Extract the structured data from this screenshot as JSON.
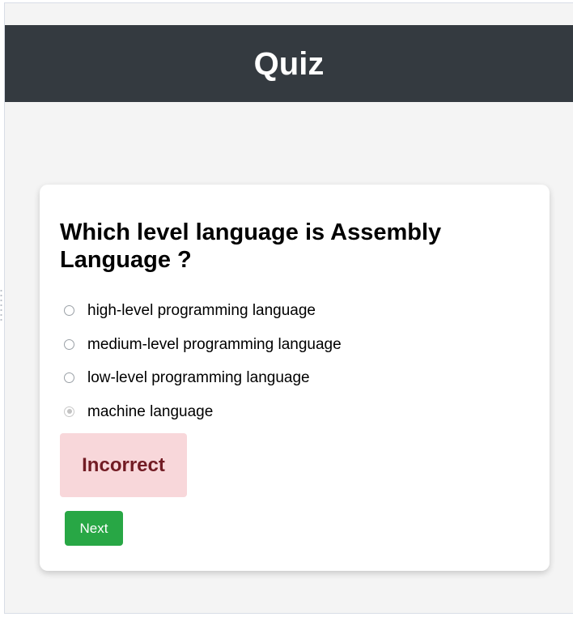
{
  "header": {
    "title": "Quiz"
  },
  "quiz": {
    "question": "Which level language is Assembly Language ?",
    "options": [
      {
        "label": "high-level programming language",
        "selected": false
      },
      {
        "label": "medium-level programming language",
        "selected": false
      },
      {
        "label": "low-level programming language",
        "selected": false
      },
      {
        "label": "machine language",
        "selected": true
      }
    ],
    "feedback": {
      "text": "Incorrect",
      "background_color": "#f8d7da",
      "text_color": "#721c24"
    },
    "next_label": "Next",
    "next_button_color": "#28a745"
  },
  "theme": {
    "header_bg": "#343a40",
    "page_bg": "#f4f4f4"
  }
}
